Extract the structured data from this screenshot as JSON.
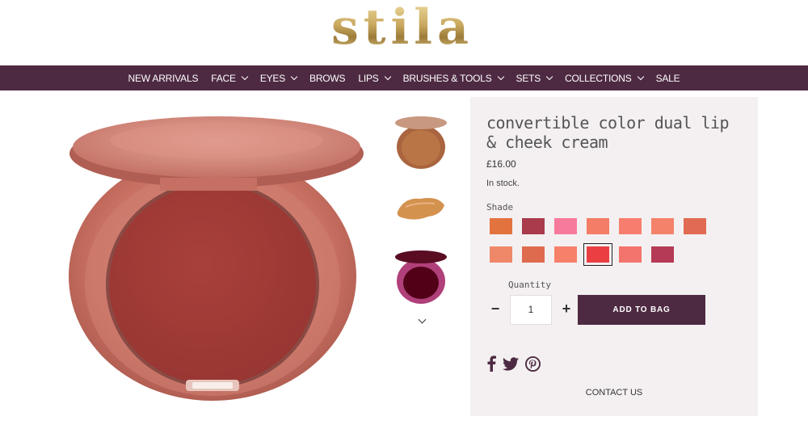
{
  "brand": {
    "logo_text": "stila",
    "accent": "#4e2a42",
    "panel_bg": "#f4f0f1"
  },
  "nav": {
    "items": [
      {
        "label": "NEW ARRIVALS",
        "dropdown": false
      },
      {
        "label": "FACE",
        "dropdown": true
      },
      {
        "label": "EYES",
        "dropdown": true
      },
      {
        "label": "BROWS",
        "dropdown": false
      },
      {
        "label": "LIPS",
        "dropdown": true
      },
      {
        "label": "BRUSHES & TOOLS",
        "dropdown": true
      },
      {
        "label": "SETS",
        "dropdown": true
      },
      {
        "label": "COLLECTIONS",
        "dropdown": true
      },
      {
        "label": "SALE",
        "dropdown": false
      }
    ]
  },
  "product": {
    "title": "convertible color dual lip & cheek cream",
    "price": "£16.00",
    "stock": "In stock.",
    "shade_label": "Shade",
    "swatches": [
      "#e2733f",
      "#a93b4c",
      "#f77a9c",
      "#f37d67",
      "#f77e6e",
      "#f4826a",
      "#e16a52",
      "#ee8868",
      "#df6b4f",
      "#f7806b",
      "#ea3f42",
      "#f3746c",
      "#b43a55"
    ],
    "selected_swatch": 10
  },
  "quantity": {
    "label": "Quantity",
    "value": "1",
    "minus": "−",
    "plus": "+"
  },
  "actions": {
    "add_to_bag": "ADD TO BAG",
    "contact_us": "CONTACT US"
  }
}
